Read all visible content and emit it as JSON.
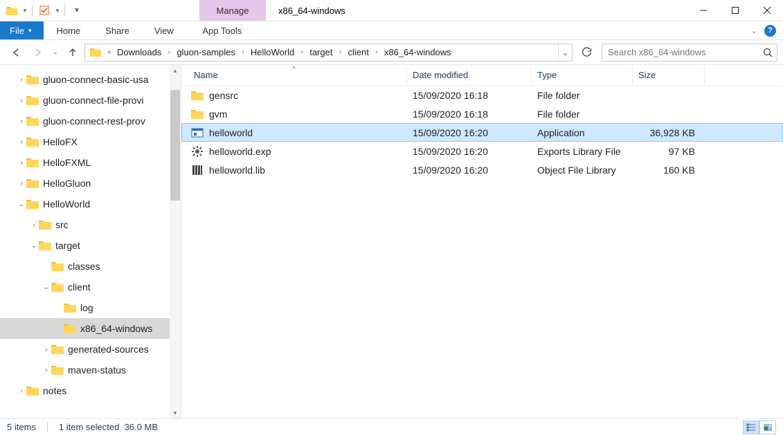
{
  "window": {
    "context_tab": "Manage",
    "context_tab_sub": "App Tools",
    "title": "x86_64-windows"
  },
  "ribbon": {
    "file": "File",
    "home": "Home",
    "share": "Share",
    "view": "View"
  },
  "breadcrumb": {
    "overflow": "«",
    "segments": [
      "Downloads",
      "gluon-samples",
      "HelloWorld",
      "target",
      "client",
      "x86_64-windows"
    ]
  },
  "search": {
    "placeholder": "Search x86_64-windows"
  },
  "tree": [
    {
      "label": "gluon-connect-basic-usa",
      "indent": 0,
      "twisty": ">"
    },
    {
      "label": "gluon-connect-file-provi",
      "indent": 0,
      "twisty": ">"
    },
    {
      "label": "gluon-connect-rest-prov",
      "indent": 0,
      "twisty": ">"
    },
    {
      "label": "HelloFX",
      "indent": 0,
      "twisty": ">"
    },
    {
      "label": "HelloFXML",
      "indent": 0,
      "twisty": ">"
    },
    {
      "label": "HelloGluon",
      "indent": 0,
      "twisty": ">"
    },
    {
      "label": "HelloWorld",
      "indent": 0,
      "twisty": "v"
    },
    {
      "label": "src",
      "indent": 1,
      "twisty": ">"
    },
    {
      "label": "target",
      "indent": 1,
      "twisty": "v"
    },
    {
      "label": "classes",
      "indent": 2,
      "twisty": ""
    },
    {
      "label": "client",
      "indent": 2,
      "twisty": "v"
    },
    {
      "label": "log",
      "indent": 3,
      "twisty": ""
    },
    {
      "label": "x86_64-windows",
      "indent": 3,
      "twisty": "",
      "selected": true
    },
    {
      "label": "generated-sources",
      "indent": 2,
      "twisty": ">"
    },
    {
      "label": "maven-status",
      "indent": 2,
      "twisty": ">"
    },
    {
      "label": "notes",
      "indent": 0,
      "twisty": ">"
    }
  ],
  "columns": {
    "name": "Name",
    "date": "Date modified",
    "type": "Type",
    "size": "Size"
  },
  "rows": [
    {
      "icon": "folder",
      "name": "gensrc",
      "date": "15/09/2020 16:18",
      "type": "File folder",
      "size": ""
    },
    {
      "icon": "folder",
      "name": "gvm",
      "date": "15/09/2020 16:18",
      "type": "File folder",
      "size": ""
    },
    {
      "icon": "app",
      "name": "helloworld",
      "date": "15/09/2020 16:20",
      "type": "Application",
      "size": "36,928 KB",
      "selected": true
    },
    {
      "icon": "gear",
      "name": "helloworld.exp",
      "date": "15/09/2020 16:20",
      "type": "Exports Library File",
      "size": "97 KB"
    },
    {
      "icon": "lib",
      "name": "helloworld.lib",
      "date": "15/09/2020 16:20",
      "type": "Object File Library",
      "size": "160 KB"
    }
  ],
  "status": {
    "items": "5 items",
    "selected": "1 item selected",
    "size": "36.0 MB"
  }
}
